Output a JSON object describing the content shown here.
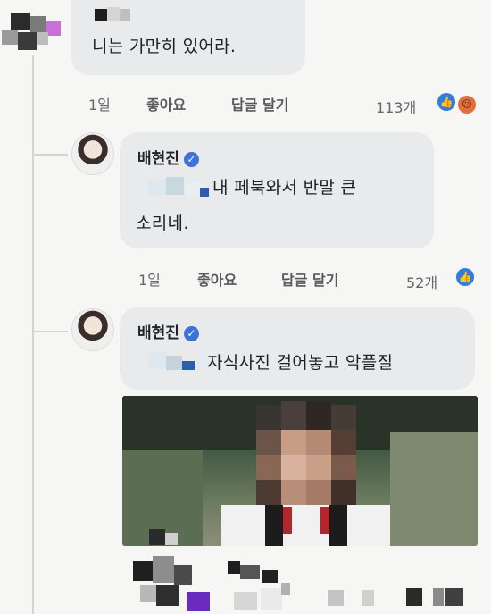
{
  "comments": [
    {
      "text": "니는 가만히 있어라.",
      "time": "1일",
      "like_label": "좋아요",
      "reply_label": "답글 달기",
      "reaction_count": "113개",
      "reactions": [
        "like-icon",
        "angry-icon"
      ]
    },
    {
      "author": "배현진",
      "text_line1": "내 페북와서 반말 큰",
      "text_line2": "소리네.",
      "time": "1일",
      "like_label": "좋아요",
      "reply_label": "답글 달기",
      "reaction_count": "52개",
      "reactions": [
        "like-icon"
      ]
    },
    {
      "author": "배현진",
      "text": "자식사진 걸어놓고 악플질"
    }
  ],
  "colors": {
    "bubble": "#e9eaec",
    "background": "#f6f6f4",
    "verified": "#3f72d8",
    "like": "#2f7de1"
  }
}
